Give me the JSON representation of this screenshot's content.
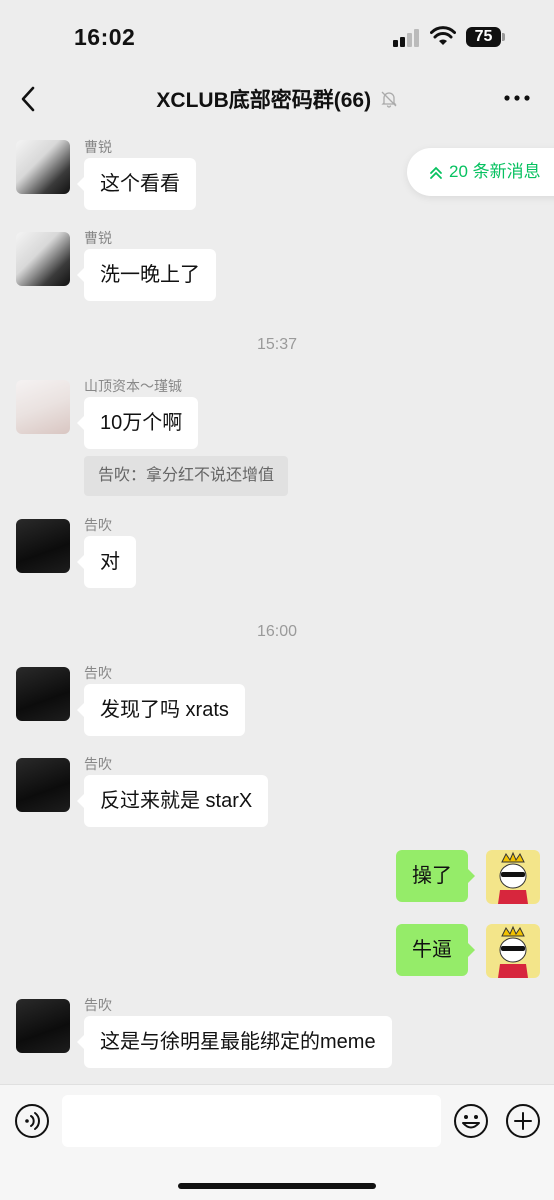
{
  "status": {
    "time": "16:02",
    "battery": "75"
  },
  "nav": {
    "title": "XCLUB底部密码群(66)"
  },
  "new_messages": {
    "label": "20 条新消息"
  },
  "messages": {
    "m1": {
      "sender": "曹锐",
      "text": "这个看看"
    },
    "m2": {
      "sender": "曹锐",
      "text": "洗一晚上了"
    },
    "t1": "15:37",
    "m3": {
      "sender": "山顶资本～瑾铖",
      "text": "10万个啊",
      "quote": "告吹：拿分红不说还增值"
    },
    "m4": {
      "sender": "告吹",
      "text": "对"
    },
    "t2": "16:00",
    "m5": {
      "sender": "告吹",
      "text": "发现了吗 xrats"
    },
    "m6": {
      "sender": "告吹",
      "text": "反过来就是 starX"
    },
    "m7": {
      "text": "操了"
    },
    "m8": {
      "text": "牛逼"
    },
    "m9": {
      "sender": "告吹",
      "text": "这是与徐明星最能绑定的meme"
    }
  },
  "colors": {
    "accent": "#07c160",
    "my_bubble": "#95ec69",
    "bg": "#ededed"
  }
}
